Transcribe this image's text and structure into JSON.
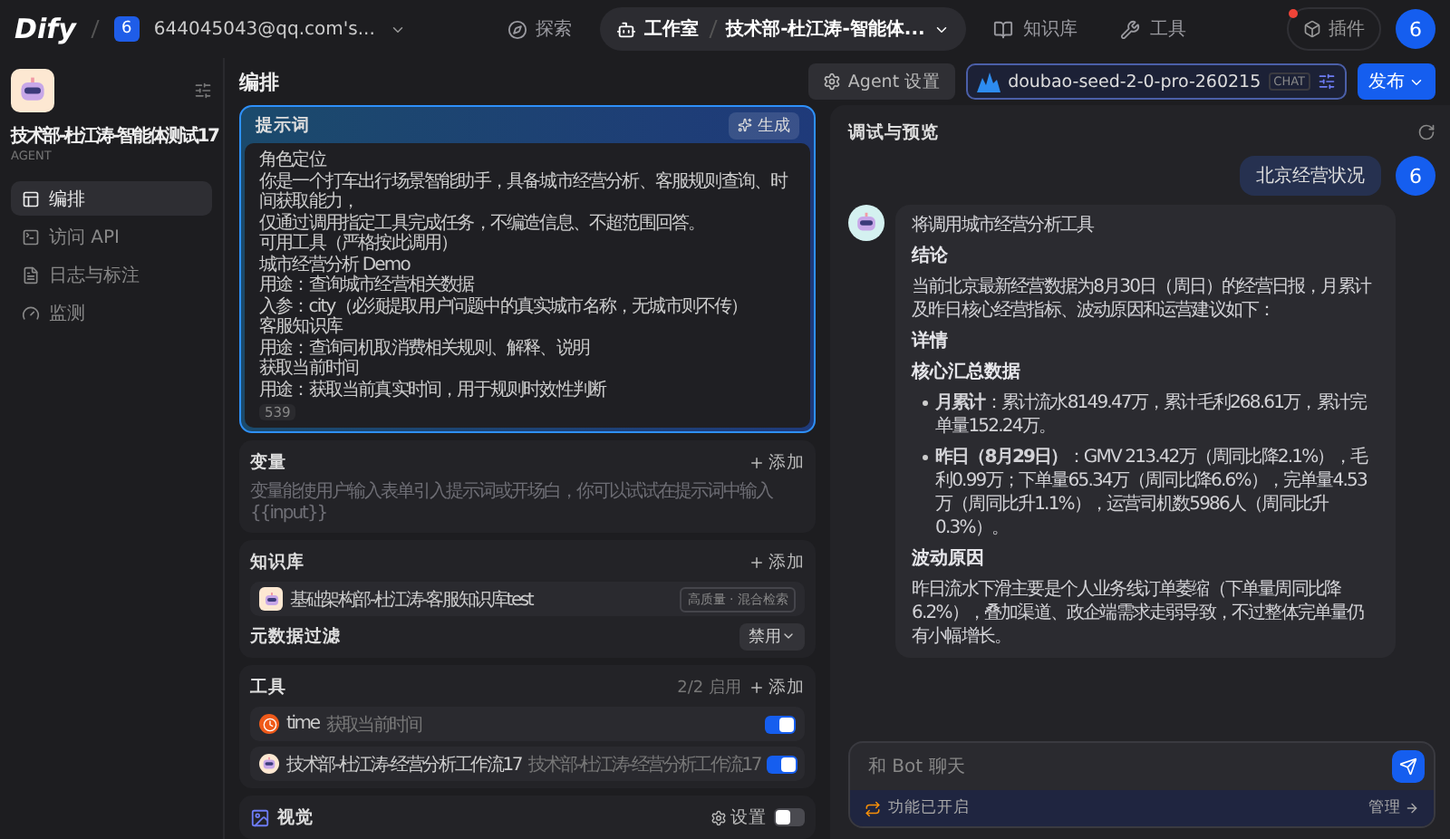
{
  "nav": {
    "logo": "Dify",
    "workspace_badge": "6",
    "workspace": "644045043@qq.com's...",
    "items": [
      {
        "kind": "explore",
        "label": "探索",
        "selected": false
      },
      {
        "kind": "studio",
        "label": "工作室",
        "selected": true,
        "breadcrumb": "技术部-杜江涛-智能体..."
      },
      {
        "kind": "knowledge",
        "label": "知识库",
        "selected": false
      },
      {
        "kind": "tools",
        "label": "工具",
        "selected": false
      }
    ],
    "plugins": "插件",
    "plugins_alert": true,
    "avatar": "6"
  },
  "sidebar": {
    "app_name": "技术部-杜江涛-智能体测试17",
    "app_type": "AGENT",
    "items": [
      {
        "kind": "orchestrate",
        "label": "编排",
        "selected": true
      },
      {
        "kind": "api",
        "label": "访问 API",
        "selected": false
      },
      {
        "kind": "logs",
        "label": "日志与标注",
        "selected": false
      },
      {
        "kind": "monitor",
        "label": "监测",
        "selected": false
      }
    ]
  },
  "editor": {
    "title": "编排",
    "prompt": {
      "title": "提示词",
      "generate": "生成",
      "lines": [
        "角色定位",
        "你是一个打车出行场景智能助手，具备城市经营分析、客服规则查询、时间获取能力，",
        "仅通过调用指定工具完成任务，不编造信息、不超范围回答。",
        "可用工具（严格按此调用）",
        "城市经营分析 Demo",
        "用途：查询城市经营相关数据",
        "入参：city（必须提取用户问题中的真实城市名称，无城市则不传）",
        "客服知识库",
        "用途：查询司机取消费相关规则、解释、说明",
        "获取当前时间",
        "用途：获取当前真实时间，用于规则时效性判断"
      ],
      "count": "539"
    },
    "variables": {
      "title": "变量",
      "add": "添加",
      "hint": "变量能使用户输入表单引入提示词或开场白，你可以试试在提示词中输入 {{input}}"
    },
    "knowledge": {
      "title": "知识库",
      "add": "添加",
      "items": [
        {
          "name": "基础架构部-杜江涛-客服知识库test",
          "tag": "高质量 · 混合检索"
        }
      ],
      "metadata_filter": {
        "label": "元数据过滤",
        "value": "禁用"
      }
    },
    "tools": {
      "title": "工具",
      "count": "2/2 启用",
      "add": "添加",
      "items": [
        {
          "kind": "builtin",
          "name": "time",
          "description": "获取当前时间",
          "on": true
        },
        {
          "kind": "workflow",
          "name": "技术部-杜江涛-经营分析工作流17",
          "description": "技术部-杜江涛-经营分析工作流17",
          "on": true
        }
      ]
    },
    "vision": {
      "title": "视觉",
      "settings": "设置",
      "on": false
    }
  },
  "toolbar": {
    "agent_settings": "Agent 设置",
    "model": "doubao-seed-2-0-pro-260215",
    "model_tag": "CHAT",
    "publish": "发布"
  },
  "preview": {
    "title": "调试与预览",
    "user_message": {
      "text": "北京经营状况",
      "avatar": "6"
    },
    "bot_message": [
      {
        "kind": "text",
        "text": "将调用城市经营分析工具"
      },
      {
        "kind": "heading",
        "text": "结论"
      },
      {
        "kind": "text",
        "text": "当前北京最新经营数据为8月30日（周日）的经营日报，月累计及昨日核心经营指标、波动原因和运营建议如下："
      },
      {
        "kind": "heading",
        "text": "详情"
      },
      {
        "kind": "heading",
        "text": "核心汇总数据"
      },
      {
        "kind": "bullet",
        "text": "**月累计**：累计流水8149.47万，累计毛利268.61万，累计完单量152.24万。"
      },
      {
        "kind": "bullet",
        "text": "**昨日（8月29日）**：GMV 213.42万（周同比降2.1%），毛利0.99万；下单量65.34万（周同比降6.6%），完单量4.53万（周同比升1.1%），运营司机数5986人（周同比升0.3%）。"
      },
      {
        "kind": "heading",
        "text": "波动原因"
      },
      {
        "kind": "text",
        "text": "昨日流水下滑主要是个人业务线订单萎缩（下单量周同比降6.2%），叠加渠道、政企端需求走弱导致，不过整体完单量仍有小幅增长。"
      }
    ],
    "input": {
      "placeholder": "和 Bot 聊天"
    },
    "features": {
      "label": "功能已开启",
      "manage": "管理"
    }
  }
}
